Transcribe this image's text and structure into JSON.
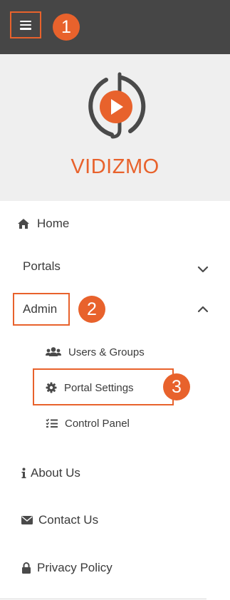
{
  "brand": {
    "name": "VIDIZMO",
    "accent_color": "#e8622c",
    "topbar_color": "#464646"
  },
  "callouts": [
    "1",
    "2",
    "3"
  ],
  "nav": {
    "home": {
      "label": "Home",
      "icon": "home-icon"
    },
    "portals": {
      "label": "Portals",
      "icon": "chevron-down-icon",
      "expanded": false
    },
    "admin": {
      "label": "Admin",
      "icon": "chevron-up-icon",
      "expanded": true,
      "children": [
        {
          "label": "Users & Groups",
          "icon": "users-icon"
        },
        {
          "label": "Portal Settings",
          "icon": "gear-icon"
        },
        {
          "label": "Control Panel",
          "icon": "checklist-icon"
        }
      ]
    },
    "about": {
      "label": "About Us",
      "icon": "info-icon"
    },
    "contact": {
      "label": "Contact Us",
      "icon": "envelope-icon"
    },
    "privacy": {
      "label": "Privacy Policy",
      "icon": "lock-icon"
    }
  }
}
